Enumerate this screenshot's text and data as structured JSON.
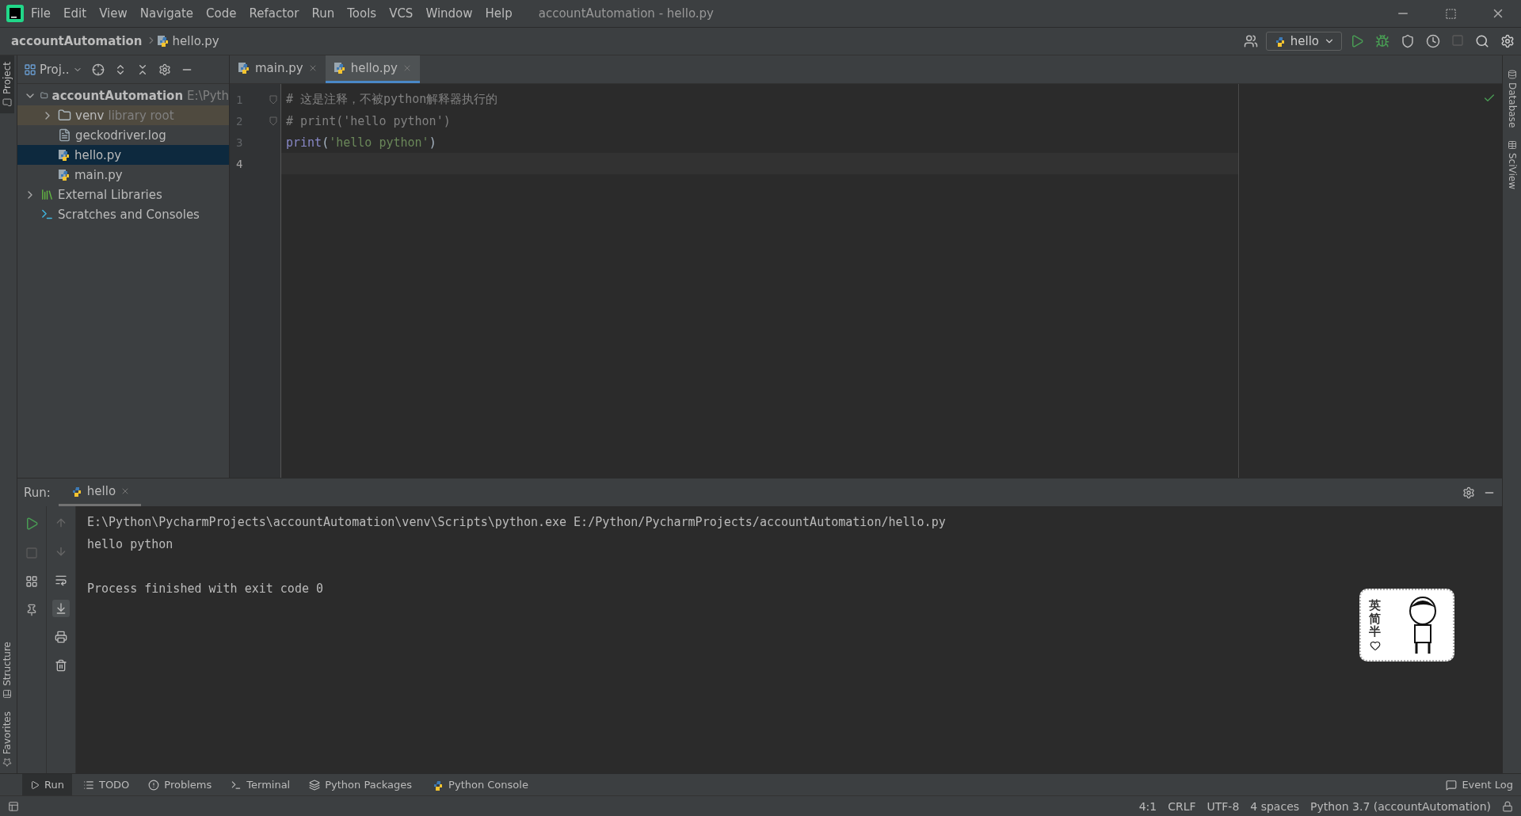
{
  "menu_bar": {
    "items": [
      "File",
      "Edit",
      "View",
      "Navigate",
      "Code",
      "Refactor",
      "Run",
      "Tools",
      "VCS",
      "Window",
      "Help"
    ],
    "window_title": "accountAutomation - hello.py"
  },
  "breadcrumb": [
    "accountAutomation",
    "hello.py"
  ],
  "run_configuration": "hello",
  "left_stripe": {
    "top": [
      {
        "label": "Project",
        "selected": true
      }
    ],
    "bottom": [
      {
        "label": "Structure",
        "selected": false
      },
      {
        "label": "Favorites",
        "selected": false
      }
    ]
  },
  "right_stripe": [
    {
      "label": "Database",
      "selected": false
    },
    {
      "label": "SciView",
      "selected": false
    }
  ],
  "project_panel": {
    "view": "Proj.."
  },
  "project_tree": [
    {
      "kind": "folder",
      "label": "accountAutomation",
      "hint": "E:\\Pyth",
      "expanded": true,
      "selected": false,
      "children": [
        {
          "kind": "root",
          "label": "venv",
          "hint": "library root",
          "expanded": false,
          "selected": false
        },
        {
          "kind": "text",
          "label": "geckodriver.log",
          "selected": false
        },
        {
          "kind": "python",
          "label": "hello.py",
          "selected": true
        },
        {
          "kind": "python",
          "label": "main.py",
          "selected": false
        }
      ]
    },
    {
      "kind": "libraries",
      "label": "External Libraries",
      "expanded": false,
      "selected": false
    },
    {
      "kind": "scratches",
      "label": "Scratches and Consoles",
      "selected": false
    }
  ],
  "editor_tabs": [
    {
      "label": "main.py",
      "selected": false
    },
    {
      "label": "hello.py",
      "selected": true
    }
  ],
  "code_lines": [
    {
      "number": "1",
      "fold": true,
      "current": false,
      "tokens": [
        {
          "kind": "comment",
          "text": "# 这是注释，不被python解释器执行的"
        }
      ]
    },
    {
      "number": "2",
      "fold": true,
      "current": false,
      "tokens": [
        {
          "kind": "comment",
          "text": "# print('hello python')"
        }
      ]
    },
    {
      "number": "3",
      "fold": false,
      "current": false,
      "tokens": [
        {
          "kind": "builtin",
          "text": "print"
        },
        {
          "kind": "plain",
          "text": "("
        },
        {
          "kind": "string",
          "text": "'hello python'"
        },
        {
          "kind": "plain",
          "text": ")"
        }
      ]
    },
    {
      "number": "4",
      "fold": false,
      "current": true
    }
  ],
  "run_panel": {
    "label": "Run:",
    "tabs": [
      {
        "label": "hello",
        "selected": true
      }
    ],
    "console_blocks": [
      [
        "E:\\Python\\PycharmProjects\\accountAutomation\\venv\\Scripts\\python.exe E:/Python/PycharmProjects/accountAutomation/hello.py",
        "hello python"
      ],
      [
        "Process finished with exit code 0"
      ]
    ]
  },
  "ime_widget": {
    "text": "英简半"
  },
  "bottom_tools": [
    {
      "kind": "run",
      "label": "Run",
      "selected": true
    },
    {
      "kind": "todo",
      "label": "TODO",
      "selected": false
    },
    {
      "kind": "problems",
      "label": "Problems",
      "selected": false
    },
    {
      "kind": "terminal",
      "label": "Terminal",
      "selected": false
    },
    {
      "kind": "packages",
      "label": "Python Packages",
      "selected": false
    },
    {
      "kind": "console",
      "label": "Python Console",
      "selected": false
    }
  ],
  "event_log": "Event Log",
  "status_bar": [
    "4:1",
    "CRLF",
    "UTF-8",
    "4 spaces",
    "Python 3.7 (accountAutomation)"
  ]
}
